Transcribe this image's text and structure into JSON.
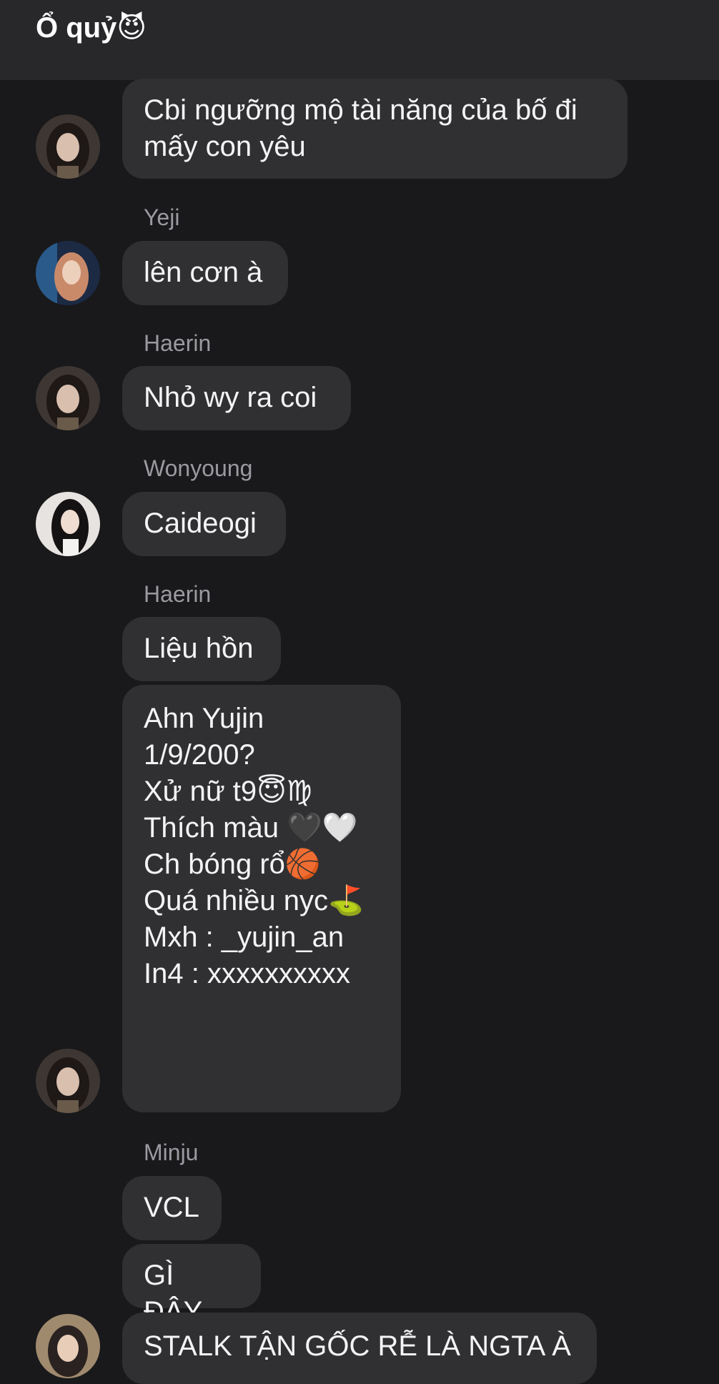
{
  "header": {
    "title": "Ổ quỷ",
    "title_emoji": "😈"
  },
  "messages": [
    {
      "sender": "",
      "text": "Cbi ngưỡng mộ tài năng của bố đi\nmấy con yêu"
    },
    {
      "sender": "Yeji",
      "text": "lên cơn à"
    },
    {
      "sender": "Haerin",
      "text": "Nhỏ wy ra coi"
    },
    {
      "sender": "Wonyoung",
      "text": "Caideogi"
    },
    {
      "sender": "Haerin",
      "text": "Liệu hồn"
    },
    {
      "sender": "",
      "text": "Ahn Yujin\n1/9/200?\nXử nữ t9😇♍\nThích màu 🖤🤍\nCh bóng rổ🏀\nQuá nhiều nyc⛳\nMxh : _yujin_an\nIn4 : xxxxxxxxxx"
    },
    {
      "sender": "Minju",
      "text": "VCL"
    },
    {
      "sender": "",
      "text": "GÌ ĐÂY"
    },
    {
      "sender": "",
      "text": "STALK TẬN GỐC RỄ LÀ NGTA À"
    }
  ],
  "avatars": [
    {
      "name": "avatar-haerin",
      "color": "#5a4a44"
    },
    {
      "name": "avatar-yeji",
      "color": "#c98a6a"
    },
    {
      "name": "avatar-haerin",
      "color": "#5a4a44"
    },
    {
      "name": "avatar-wonyoung",
      "color": "#d8d4d2"
    },
    {
      "name": "avatar-haerin",
      "color": "#5a4a44"
    },
    {
      "name": "avatar-minju",
      "color": "#8a6a5a"
    }
  ]
}
